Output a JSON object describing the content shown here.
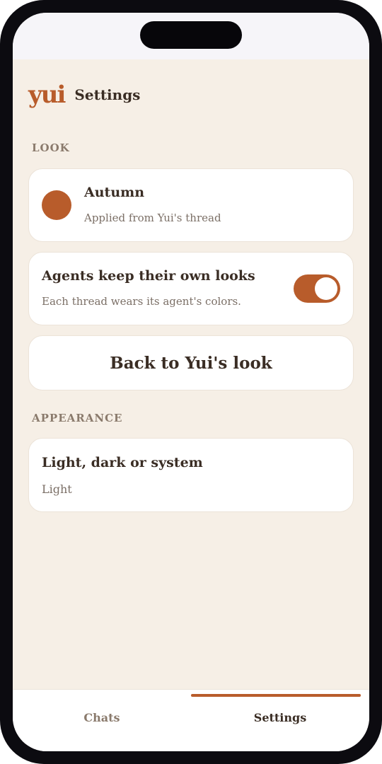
{
  "app": {
    "logo": "yui",
    "page_title": "Settings"
  },
  "colors": {
    "accent": "#b85c2b",
    "background": "#f6efe6",
    "card": "#ffffff",
    "text": "#3a2d24",
    "muted": "#7b6f66"
  },
  "look_section": {
    "label": "LOOK",
    "theme": {
      "title": "Autumn",
      "subtitle": "Applied from Yui's thread",
      "swatch_color": "#b85c2b"
    },
    "agents_toggle": {
      "title": "Agents keep their own looks",
      "subtitle": "Each thread wears its agent's colors.",
      "enabled": true
    },
    "reset_button": "Back to Yui's look"
  },
  "appearance_section": {
    "label": "APPEARANCE",
    "mode": {
      "title": "Light, dark or system",
      "value": "Light"
    }
  },
  "tabbar": {
    "tabs": [
      {
        "label": "Chats",
        "active": false
      },
      {
        "label": "Settings",
        "active": true
      }
    ]
  }
}
